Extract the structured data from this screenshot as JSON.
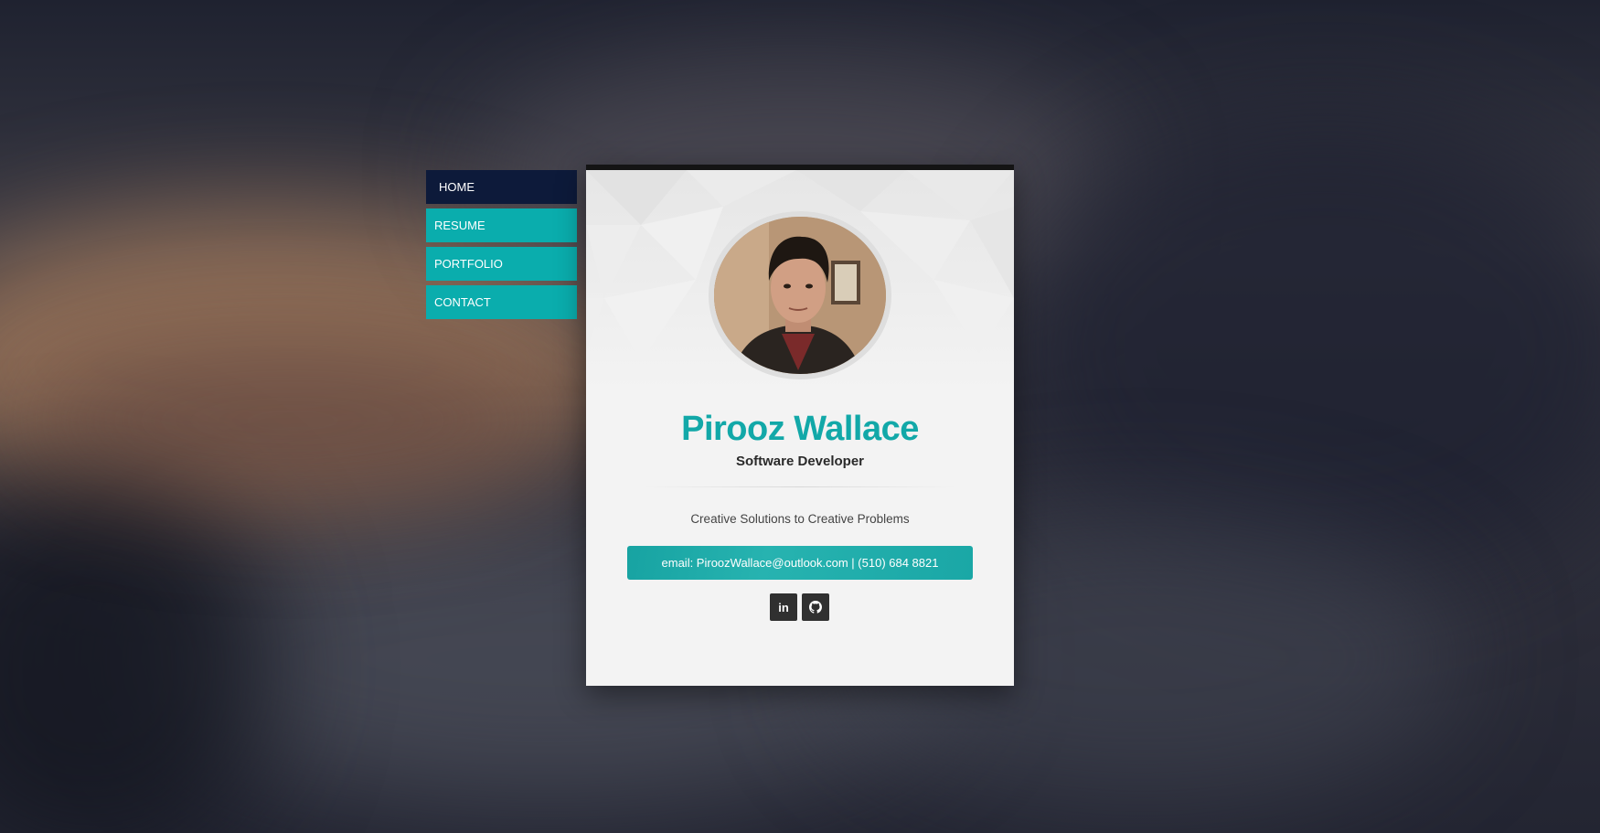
{
  "menu": {
    "items": [
      {
        "label": "HOME",
        "active": true
      },
      {
        "label": "RESUME",
        "active": false
      },
      {
        "label": "PORTFOLIO",
        "active": false
      },
      {
        "label": "CONTACT",
        "active": false
      }
    ]
  },
  "profile": {
    "name": "Pirooz Wallace",
    "role": "Software Developer",
    "tagline": "Creative Solutions to Creative Problems",
    "contact": "email: PiroozWallace@outlook.com | (510) 684 8821"
  },
  "social": {
    "linkedin_icon": "linkedin-icon",
    "github_icon": "github-icon"
  },
  "colors": {
    "accent": "#12a8a8",
    "menu_active": "#0d1a3a",
    "menu_item": "#0aadad",
    "card_bg": "#f3f3f3",
    "social_bg": "#303030"
  }
}
